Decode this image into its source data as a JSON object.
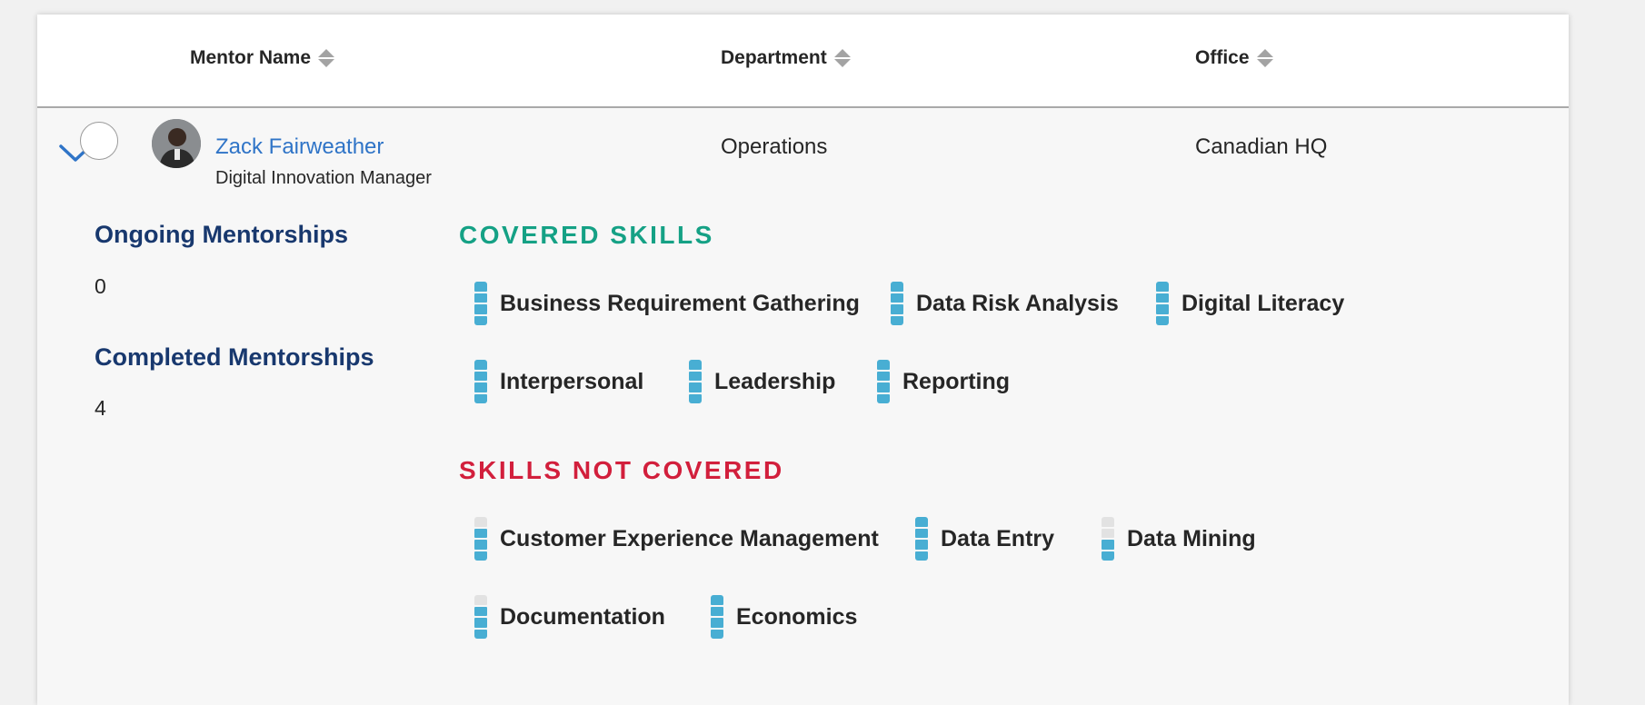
{
  "table": {
    "columns": [
      {
        "label": "Mentor Name"
      },
      {
        "label": "Department"
      },
      {
        "label": "Office"
      }
    ]
  },
  "mentor": {
    "name": "Zack Fairweather",
    "title": "Digital Innovation Manager",
    "department": "Operations",
    "office": "Canadian HQ",
    "avatar_icon": "person-photo"
  },
  "stats": {
    "ongoing_label": "Ongoing Mentorships",
    "ongoing_value": "0",
    "completed_label": "Completed Mentorships",
    "completed_value": "4"
  },
  "covered": {
    "title": "COVERED SKILLS",
    "color": "#15a185",
    "skills": [
      {
        "label": "Business Requirement Gathering",
        "level_of_4": 4
      },
      {
        "label": "Data Risk Analysis",
        "level_of_4": 4
      },
      {
        "label": "Digital Literacy",
        "level_of_4": 4
      },
      {
        "label": "Interpersonal",
        "level_of_4": 4
      },
      {
        "label": "Leadership",
        "level_of_4": 4
      },
      {
        "label": "Reporting",
        "level_of_4": 4
      }
    ]
  },
  "not_covered": {
    "title": "SKILLS NOT COVERED",
    "color": "#d21f3c",
    "skills": [
      {
        "label": "Customer Experience Management",
        "level_of_4": 3
      },
      {
        "label": "Data Entry",
        "level_of_4": 4
      },
      {
        "label": "Data Mining",
        "level_of_4": 2
      },
      {
        "label": "Documentation",
        "level_of_4": 3
      },
      {
        "label": "Economics",
        "level_of_4": 4
      }
    ]
  },
  "colors": {
    "link": "#2f74c7",
    "stat_label": "#18386e",
    "meter_fill": "#48aed3",
    "meter_empty": "#e2e2e2"
  }
}
